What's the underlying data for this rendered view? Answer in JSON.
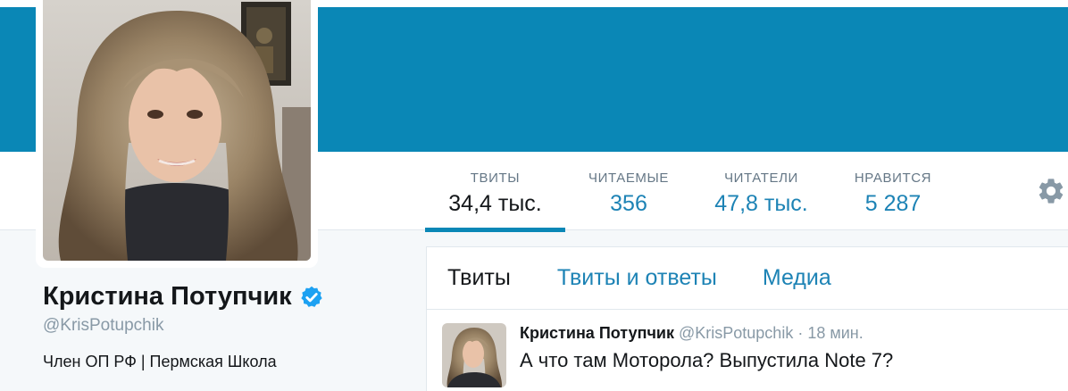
{
  "colors": {
    "banner": "#0a87b6",
    "link": "#1d83b5",
    "muted": "#657786",
    "verified": "#1da1f2"
  },
  "profile": {
    "name": "Кристина Потупчик",
    "handle": "@KrisPotupchik",
    "bio": "Член ОП РФ | Пермская Школа",
    "verified": true,
    "avatar_icon": "profile-photo"
  },
  "stats": [
    {
      "label": "ТВИТЫ",
      "value": "34,4 тыс.",
      "active": true
    },
    {
      "label": "ЧИТАЕМЫЕ",
      "value": "356",
      "active": false
    },
    {
      "label": "ЧИТАТЕЛИ",
      "value": "47,8 тыс.",
      "active": false
    },
    {
      "label": "НРАВИТСЯ",
      "value": "5 287",
      "active": false
    }
  ],
  "settings_icon": "gear-icon",
  "tabs": [
    {
      "label": "Твиты",
      "active": true
    },
    {
      "label": "Твиты и ответы",
      "active": false
    },
    {
      "label": "Медиа",
      "active": false
    }
  ],
  "tweet": {
    "name": "Кристина Потупчик",
    "handle": "@KrisPotupchik",
    "separator": "·",
    "time": "18 мин.",
    "text": "А что там Моторола? Выпустила Note 7?"
  }
}
